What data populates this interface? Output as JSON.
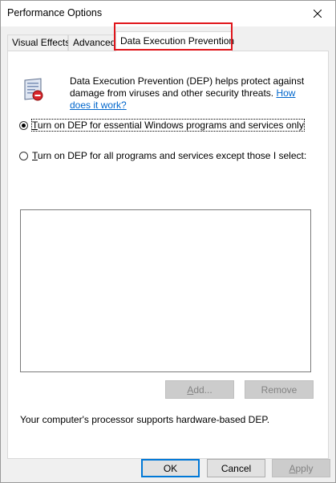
{
  "window": {
    "title": "Performance Options"
  },
  "tabs": [
    {
      "label": "Visual Effects"
    },
    {
      "label": "Advanced"
    },
    {
      "label": "Data Execution Prevention"
    }
  ],
  "dep": {
    "icon": "dep-shield-icon",
    "description": "Data Execution Prevention (DEP) helps protect against damage from viruses and other security threats.",
    "link_text": "How does it work?",
    "radio_essential": {
      "prefix": "T",
      "rest": "urn on DEP for essential Windows programs and services only",
      "checked": true
    },
    "radio_all": {
      "prefix": "T",
      "rest": "urn on DEP for all programs and services except those I select:",
      "checked": false
    },
    "add_button": {
      "prefix": "A",
      "rest": "dd..."
    },
    "remove_button": "Remove",
    "processor_info": "Your computer's processor supports hardware-based DEP."
  },
  "footer": {
    "ok": "OK",
    "cancel": "Cancel",
    "apply_prefix": "A",
    "apply_rest": "pply"
  },
  "colors": {
    "highlight": "#e0151b",
    "link": "#0066cc",
    "default_button_border": "#0078d7"
  }
}
